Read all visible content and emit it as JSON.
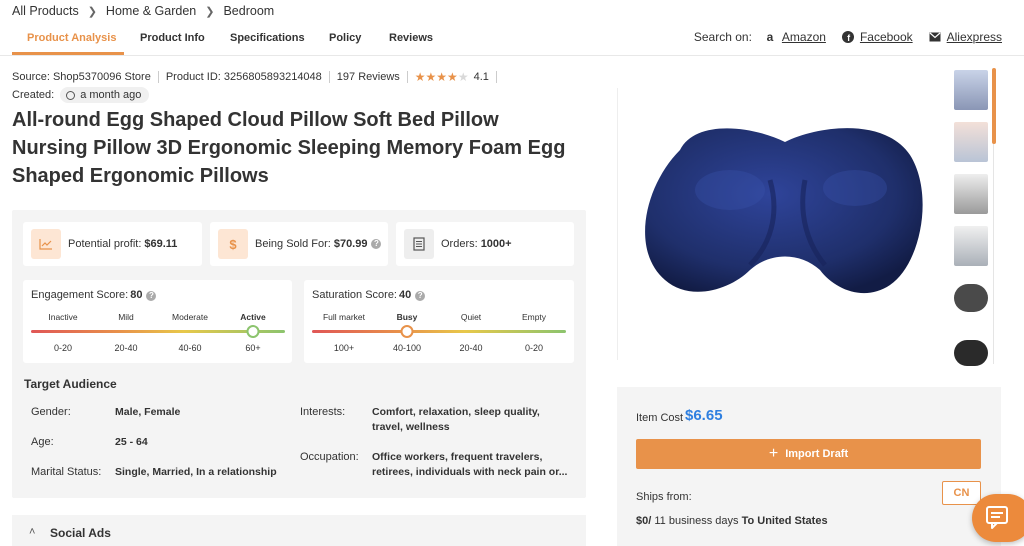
{
  "breadcrumb": [
    "All Products",
    "Home & Garden",
    "Bedroom"
  ],
  "tabs": [
    "Product Analysis",
    "Product Info",
    "Specifications",
    "Policy",
    "Reviews"
  ],
  "search_on": {
    "label": "Search on:",
    "sites": [
      {
        "name": "Amazon",
        "icon": "amazon-icon"
      },
      {
        "name": "Facebook",
        "icon": "facebook-icon"
      },
      {
        "name": "Aliexpress",
        "icon": "mail-icon"
      }
    ]
  },
  "meta": {
    "source": "Source: Shop5370096 Store",
    "product_id": "Product ID: 3256805893214048",
    "reviews": "197 Reviews",
    "rating": "4.1",
    "rating_value": 4.1,
    "created_label": "Created:",
    "created_value": "a month ago"
  },
  "title": "All-round Egg Shaped Cloud Pillow Soft Bed Pillow Nursing Pillow 3D Ergonomic Sleeping Memory Foam Egg Shaped Ergonomic Pillows",
  "stats": {
    "profit_label": "Potential profit:",
    "profit_value": "$69.11",
    "sold_label": "Being Sold For:",
    "sold_value": "$70.99",
    "orders_label": "Orders:",
    "orders_value": "1000+"
  },
  "engagement": {
    "label": "Engagement Score:",
    "value": "80",
    "levels": [
      "Inactive",
      "Mild",
      "Moderate",
      "Active"
    ],
    "ranges": [
      "0-20",
      "20-40",
      "40-60",
      "60+"
    ],
    "selected_index": 3
  },
  "saturation": {
    "label": "Saturation Score:",
    "value": "40",
    "levels": [
      "Full market",
      "Busy",
      "Quiet",
      "Empty"
    ],
    "ranges": [
      "100+",
      "40-100",
      "20-40",
      "0-20"
    ],
    "selected_index": 1
  },
  "audience": {
    "title": "Target Audience",
    "gender_label": "Gender:",
    "gender_value": "Male, Female",
    "age_label": "Age:",
    "age_value": "25 - 64",
    "marital_label": "Marital Status:",
    "marital_value": "Single, Married, In a relationship",
    "interests_label": "Interests:",
    "interests_value": "Comfort, relaxation, sleep quality, travel, wellness",
    "occupation_label": "Occupation:",
    "occupation_value": "Office workers, frequent travelers, retirees, individuals with neck pain or..."
  },
  "social_ads": "Social Ads",
  "pricing": {
    "item_cost_label": "Item Cost",
    "item_cost_value": "$6.65",
    "import_label": "Import Draft",
    "ships_from_label": "Ships from:",
    "ships_from_value": "CN",
    "shipping_cost": "$0/",
    "shipping_days": " 11 business days ",
    "shipping_dest": "To United States"
  },
  "colors": {
    "accent": "#e8924a",
    "price_blue": "#2e7fe0",
    "pillow": "#1f2f6b"
  }
}
